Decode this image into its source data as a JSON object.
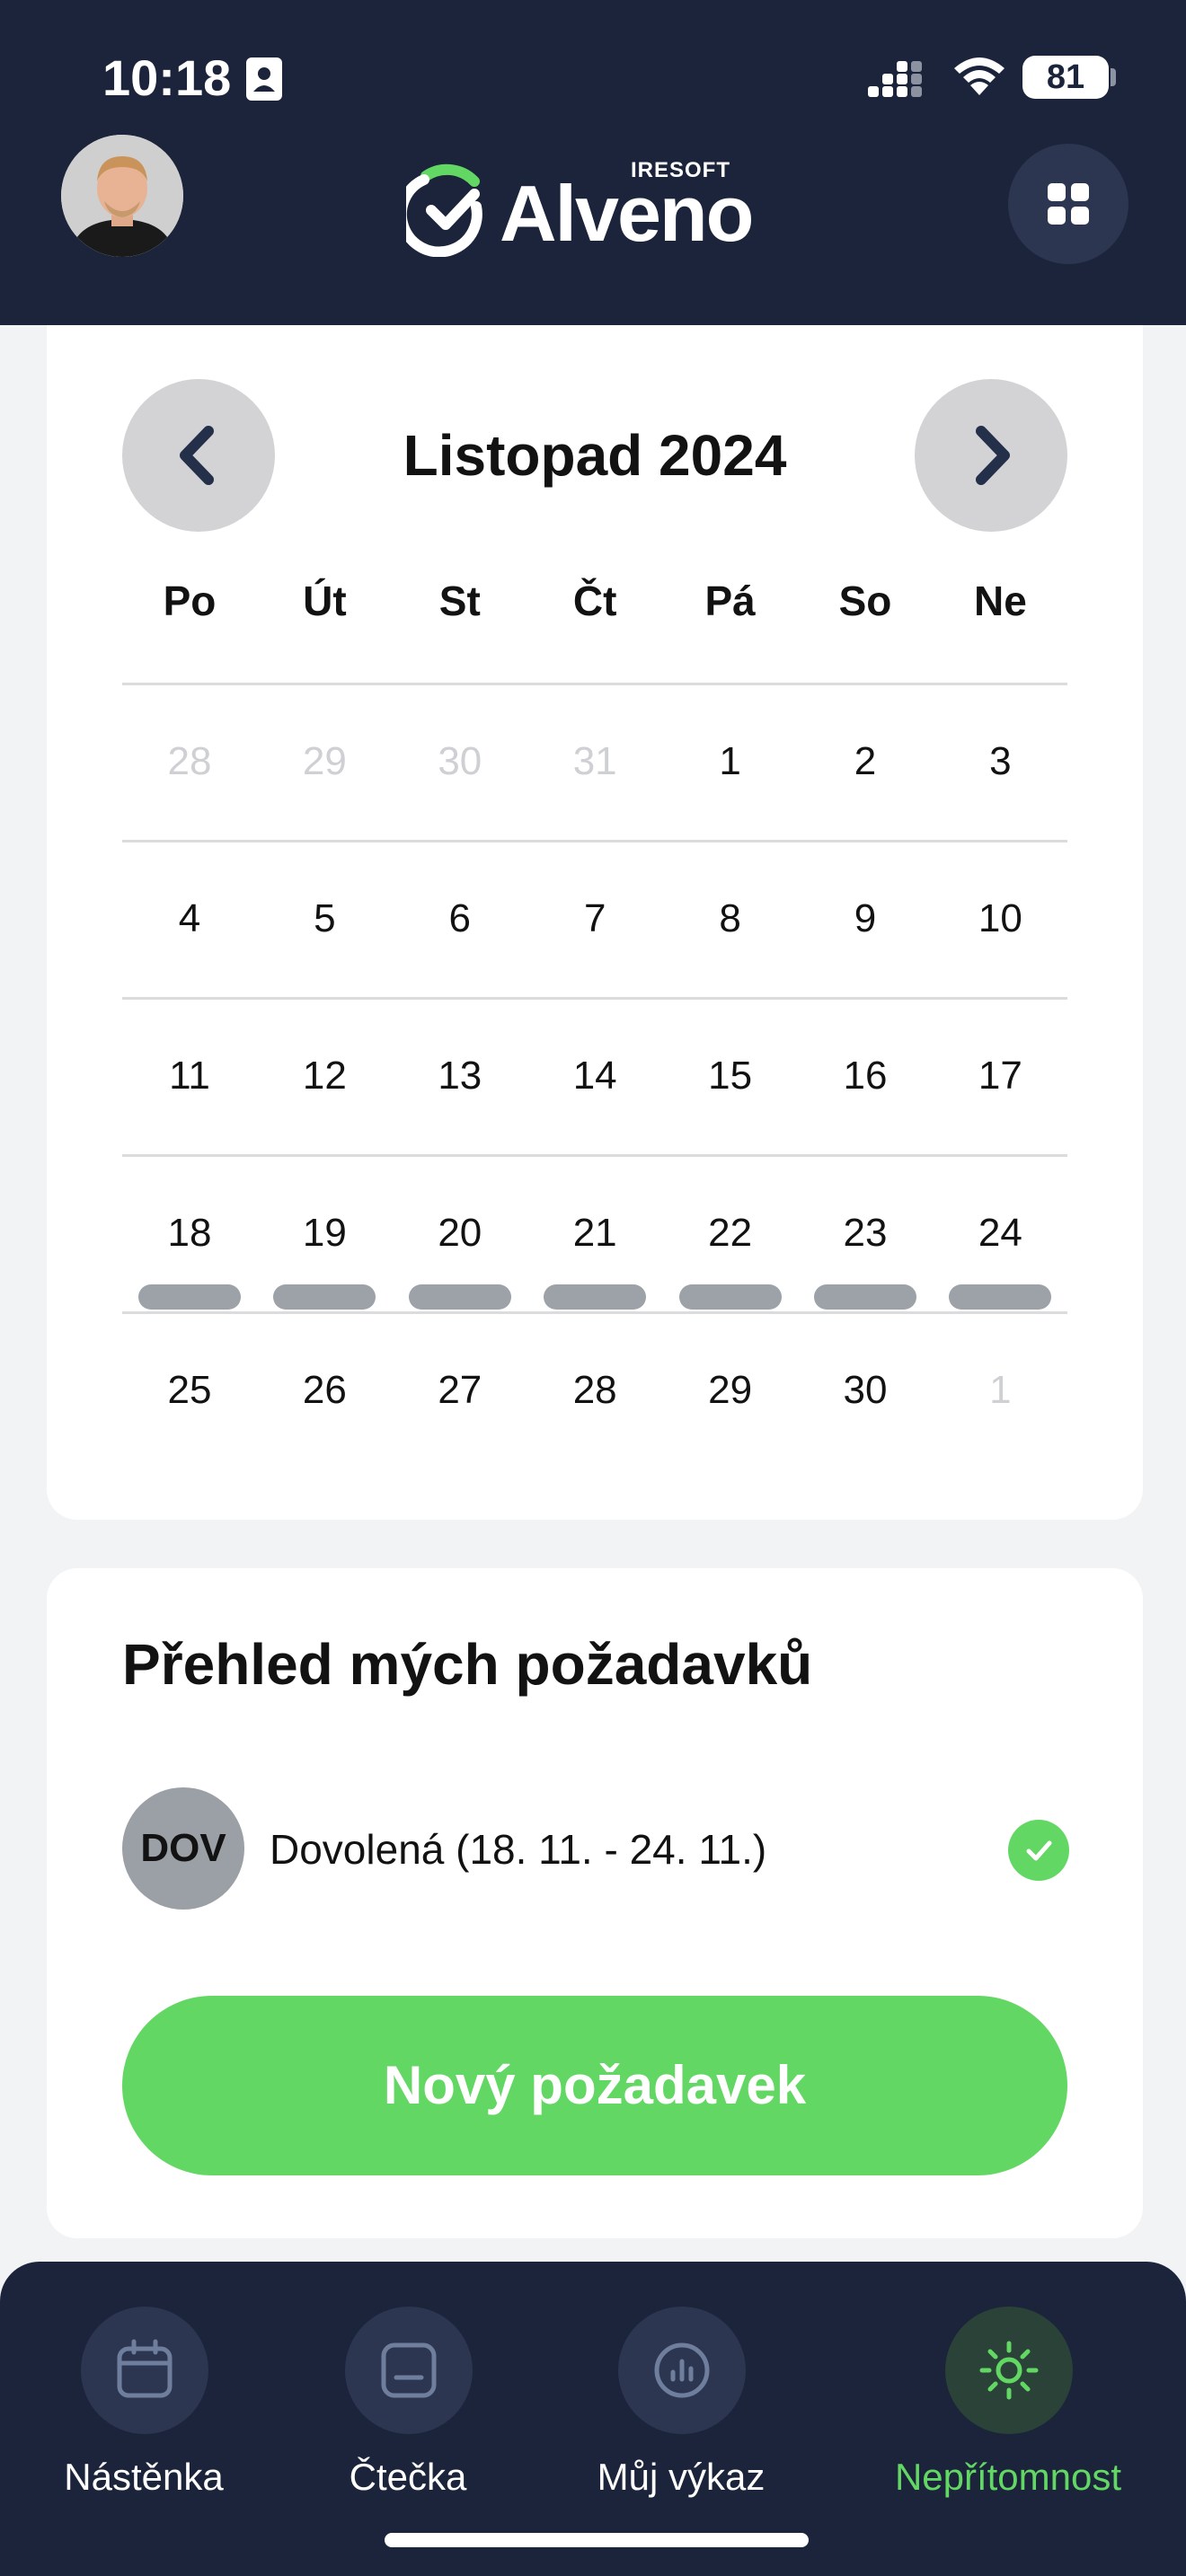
{
  "status_bar": {
    "time": "10:18",
    "battery": "81"
  },
  "header": {
    "logo_brand": "Alveno",
    "logo_sub": "IRESOFT",
    "accent_color": "#63d764",
    "background_color": "#1b243a",
    "apps_icon": "grid-icon"
  },
  "calendar": {
    "month_title": "Listopad 2024",
    "prev_icon": "chevron-left-icon",
    "next_icon": "chevron-right-icon",
    "weekdays": [
      "Po",
      "Út",
      "St",
      "Čt",
      "Pá",
      "So",
      "Ne"
    ],
    "weeks": [
      {
        "days": [
          {
            "n": "28",
            "muted": true
          },
          {
            "n": "29",
            "muted": true
          },
          {
            "n": "30",
            "muted": true
          },
          {
            "n": "31",
            "muted": true
          },
          {
            "n": "1"
          },
          {
            "n": "2"
          },
          {
            "n": "3"
          }
        ]
      },
      {
        "days": [
          {
            "n": "4"
          },
          {
            "n": "5"
          },
          {
            "n": "6"
          },
          {
            "n": "7"
          },
          {
            "n": "8"
          },
          {
            "n": "9"
          },
          {
            "n": "10"
          }
        ]
      },
      {
        "days": [
          {
            "n": "11"
          },
          {
            "n": "12"
          },
          {
            "n": "13"
          },
          {
            "n": "14"
          },
          {
            "n": "15"
          },
          {
            "n": "16"
          },
          {
            "n": "17"
          }
        ]
      },
      {
        "days": [
          {
            "n": "18",
            "absence": true
          },
          {
            "n": "19",
            "absence": true
          },
          {
            "n": "20",
            "absence": true
          },
          {
            "n": "21",
            "absence": true
          },
          {
            "n": "22",
            "absence": true
          },
          {
            "n": "23",
            "absence": true
          },
          {
            "n": "24",
            "absence": true
          }
        ]
      },
      {
        "days": [
          {
            "n": "25"
          },
          {
            "n": "26"
          },
          {
            "n": "27"
          },
          {
            "n": "28"
          },
          {
            "n": "29"
          },
          {
            "n": "30"
          },
          {
            "n": "1",
            "muted": true
          }
        ]
      }
    ],
    "absence_bar_color": "#9da1a8"
  },
  "requests": {
    "title": "Přehled mých požadavků",
    "items": [
      {
        "badge": "DOV",
        "text": "Dovolená (18. 11. - 24. 11.)",
        "status_icon": "check-icon"
      }
    ],
    "new_button": "Nový požadavek"
  },
  "tabbar": {
    "tabs": [
      {
        "label": "Nástěnka",
        "icon": "calendar-icon",
        "active": false
      },
      {
        "label": "Čtečka",
        "icon": "card-reader-icon",
        "active": false
      },
      {
        "label": "Můj výkaz",
        "icon": "bar-chart-icon",
        "active": false
      },
      {
        "label": "Nepřítomnost",
        "icon": "sun-icon",
        "active": true
      }
    ]
  }
}
